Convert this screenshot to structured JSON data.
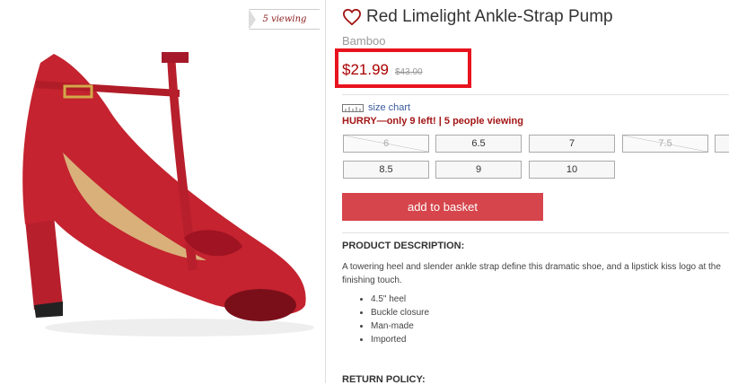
{
  "viewing_flag": "5 viewing",
  "product": {
    "title": "Red Limelight Ankle-Strap Pump",
    "brand": "Bamboo",
    "price": "$21.99",
    "old_price": "$43.00",
    "accent_color": "#e8131e",
    "favorite_icon": "heart-icon"
  },
  "size_chart": {
    "label": "size chart",
    "icon": "ruler-icon"
  },
  "urgency": "HURRY—only 9 left! | 5 people viewing",
  "sizes": [
    {
      "label": "6",
      "available": false
    },
    {
      "label": "6.5",
      "available": true
    },
    {
      "label": "7",
      "available": true
    },
    {
      "label": "7.5",
      "available": false
    },
    {
      "label": "8.5",
      "available": true
    },
    {
      "label": "9",
      "available": true
    },
    {
      "label": "10",
      "available": true
    }
  ],
  "add_to_basket": "add to basket",
  "description": {
    "heading": "PRODUCT DESCRIPTION:",
    "text": "A towering heel and slender ankle strap define this dramatic shoe, and a lipstick kiss logo at the finishing touch.",
    "bullets": [
      "4.5\" heel",
      "Buckle closure",
      "Man-made",
      "Imported"
    ]
  },
  "return_heading": "RETURN POLICY:"
}
